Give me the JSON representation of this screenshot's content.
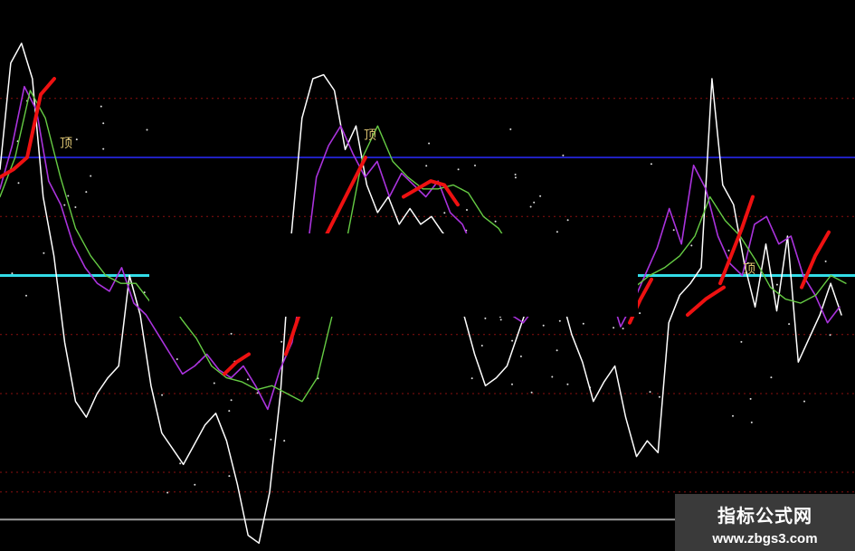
{
  "chart_data": {
    "type": "line",
    "title": "",
    "xlabel": "",
    "ylabel": "",
    "grid": true,
    "ylim": [
      -20,
      120
    ],
    "levels": [
      {
        "name": "blue-line",
        "y": 80,
        "color": "#2020c0"
      },
      {
        "name": "cyan-line",
        "y": 50,
        "color": "#33dde8"
      },
      {
        "name": "gray-line",
        "y": -12,
        "color": "#9a9a9a"
      }
    ],
    "gridlines": [
      95,
      65,
      35,
      20,
      0,
      -5
    ],
    "series": [
      {
        "name": "",
        "color": "#ffffff",
        "values": [
          77,
          104,
          109,
          100,
          70,
          55,
          33,
          18,
          14,
          20,
          24,
          27,
          50,
          40,
          22,
          10,
          6,
          2,
          7,
          12,
          15,
          8,
          -3,
          -16,
          -18,
          -5,
          20,
          60,
          90,
          100,
          101,
          97,
          82,
          88,
          73,
          66,
          70,
          63,
          67,
          63,
          65,
          61,
          58,
          40,
          30,
          22,
          24,
          27,
          35,
          43,
          48,
          50,
          45,
          35,
          28,
          18,
          23,
          27,
          14,
          4,
          8,
          5,
          38,
          45,
          48,
          52,
          100,
          73,
          68,
          53,
          42,
          58,
          41,
          60,
          28,
          34,
          40,
          48,
          40
        ]
      },
      {
        "name": "",
        "color": "#aa33dd",
        "values": [
          72,
          83,
          98,
          92,
          74,
          68,
          58,
          52,
          48,
          46,
          52,
          43,
          40,
          35,
          30,
          25,
          27,
          30,
          26,
          24,
          27,
          22,
          16,
          26,
          33,
          50,
          75,
          83,
          88,
          81,
          75,
          79,
          70,
          76,
          73,
          70,
          74,
          66,
          63,
          56,
          46,
          43,
          40,
          38,
          42,
          48,
          46,
          42,
          47,
          50,
          47,
          37,
          43,
          50,
          57,
          67,
          58,
          78,
          72,
          60,
          53,
          50,
          63,
          65,
          58,
          60,
          50,
          45,
          38,
          42
        ]
      },
      {
        "name": "",
        "color": "#66cc44",
        "values": [
          70,
          80,
          97,
          90,
          75,
          62,
          55,
          50,
          48,
          48,
          43,
          45,
          39,
          34,
          27,
          24,
          23,
          21,
          22,
          20,
          18,
          24,
          40,
          60,
          80,
          88,
          79,
          75,
          72,
          72,
          73,
          71,
          65,
          62,
          56,
          50,
          45,
          42,
          40,
          40,
          43,
          45,
          47,
          50,
          52,
          55,
          60,
          70,
          64,
          60,
          54,
          47,
          44,
          43,
          45,
          50,
          48
        ]
      },
      {
        "name": "",
        "color": "#ee1111",
        "values": [
          75,
          77,
          80,
          96,
          100
        ]
      },
      {
        "name": "",
        "color": "#ee1111",
        "values": [
          25,
          28,
          30
        ]
      },
      {
        "name": "",
        "color": "#ee1111",
        "values": [
          30,
          45,
          60,
          70,
          80
        ]
      },
      {
        "name": "",
        "color": "#ee1111",
        "values": [
          70,
          72,
          74,
          73,
          68
        ]
      },
      {
        "name": "",
        "color": "#ee1111",
        "values": [
          38,
          44,
          49
        ]
      },
      {
        "name": "",
        "color": "#ee1111",
        "values": [
          40,
          44,
          47
        ]
      },
      {
        "name": "",
        "color": "#ee1111",
        "values": [
          48,
          55,
          62,
          70
        ]
      },
      {
        "name": "",
        "color": "#ee1111",
        "values": [
          47,
          55,
          61
        ]
      }
    ],
    "annotations": [
      "顶",
      "顶",
      "顶"
    ]
  },
  "watermark": {
    "title": "指标公式网",
    "url": "www.zbgs3.com"
  }
}
